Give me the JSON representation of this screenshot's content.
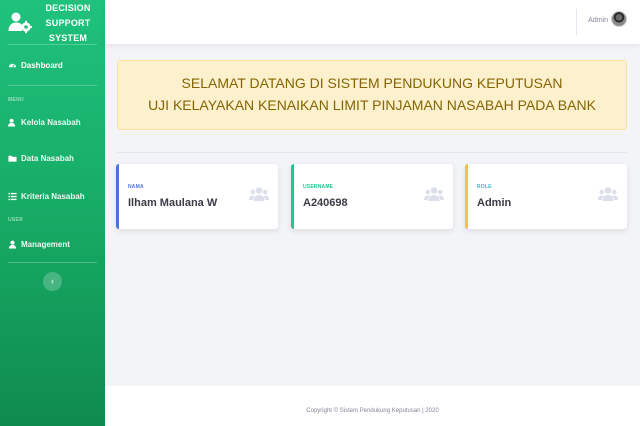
{
  "sidebar": {
    "brand": {
      "line1": "DECISION",
      "line2": "SUPPORT",
      "line3": "SYSTEM",
      "icon": "users-cog-icon"
    },
    "dashboard_label": "Dashboard",
    "heading_menu": "MENU",
    "items": [
      {
        "label": "Kelola Nasabah",
        "icon": "user-edit-icon"
      },
      {
        "label": "Data Nasabah",
        "icon": "folder-icon"
      },
      {
        "label": "Kriteria Nasabah",
        "icon": "list-icon"
      }
    ],
    "heading_user": "USER",
    "management_label": "Management",
    "toggle_symbol": "‹"
  },
  "topbar": {
    "user_name": "Admin"
  },
  "banner": {
    "line1": "SELAMAT DATANG DI SISTEM PENDUKUNG KEPUTUSAN",
    "line2": "UJI KELAYAKAN KENAIKAN LIMIT PINJAMAN NASABAH PADA BANK"
  },
  "cards": [
    {
      "label": "NAMA",
      "value": "Ilham Maulana W",
      "accent": "#4e73df"
    },
    {
      "label": "USERNAME",
      "value": "A240698",
      "accent": "#1cc88a"
    },
    {
      "label": "ROLE",
      "value": "Admin",
      "accent": "#f6c23e"
    }
  ],
  "footer": {
    "text": "Copyright © Sistem Pendukung Keputusan | 2020"
  },
  "colors": {
    "sidebar": "#1cc88a",
    "banner_bg": "#fdf0cc",
    "banner_text": "#856404"
  }
}
